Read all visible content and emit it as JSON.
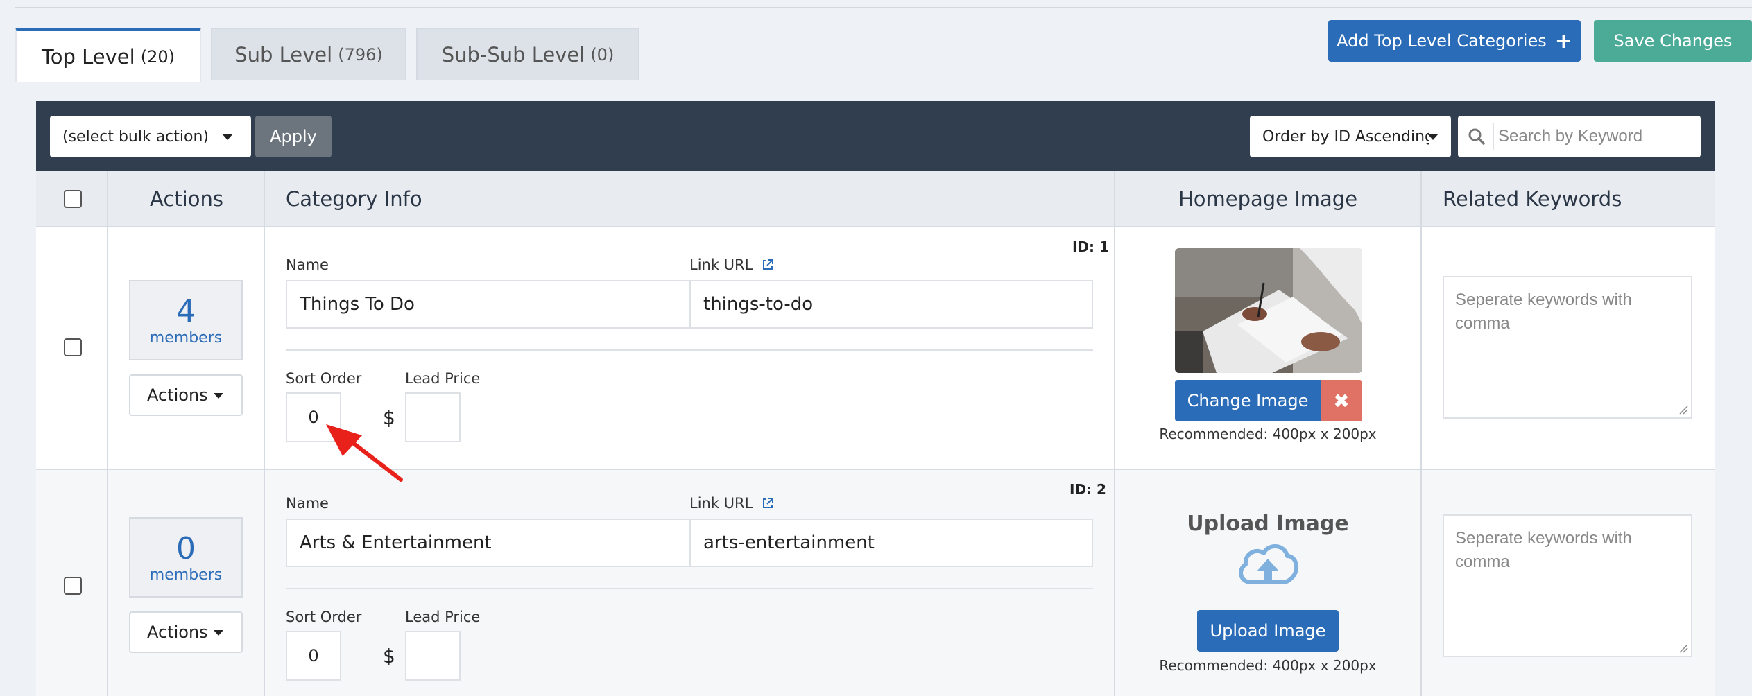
{
  "tabs": [
    {
      "label": "Top Level",
      "count": "(20)"
    },
    {
      "label": "Sub Level",
      "count": "(796)"
    },
    {
      "label": "Sub-Sub Level",
      "count": "(0)"
    }
  ],
  "header_buttons": {
    "add_top": "Add Top Level Categories",
    "add_icon": "+",
    "save": "Save Changes"
  },
  "toolbar": {
    "bulk_action": "(select bulk action)",
    "apply": "Apply",
    "order_by": "Order by ID Ascending",
    "search_placeholder": "Search by Keyword"
  },
  "columns": {
    "actions": "Actions",
    "category_info": "Category Info",
    "homepage_image": "Homepage Image",
    "related_keywords": "Related Keywords"
  },
  "rows": [
    {
      "id_label": "ID: 1",
      "members_count": "4",
      "members_label": "members",
      "actions_label": "Actions",
      "name_label": "Name",
      "name": "Things To Do",
      "link_label": "Link URL",
      "link": "things-to-do",
      "sort_label": "Sort Order",
      "sort_order": "0",
      "lead_label": "Lead Price",
      "currency": "$",
      "lead_price": "",
      "change_image": "Change Image",
      "remove_icon": "✖",
      "recommended": "Recommended: 400px x 200px",
      "keywords_placeholder": "Seperate keywords with comma"
    },
    {
      "id_label": "ID: 2",
      "members_count": "0",
      "members_label": "members",
      "actions_label": "Actions",
      "name_label": "Name",
      "name": "Arts & Entertainment",
      "link_label": "Link URL",
      "link": "arts-entertainment",
      "sort_label": "Sort Order",
      "sort_order": "0",
      "lead_label": "Lead Price",
      "currency": "$",
      "lead_price": "",
      "upload_title": "Upload Image",
      "upload_button": "Upload Image",
      "recommended": "Recommended: 400px x 200px",
      "keywords_placeholder": "Seperate keywords with comma"
    }
  ],
  "colors": {
    "primary": "#2b6cb8",
    "save": "#4cab97",
    "toolbar": "#313e4f",
    "danger": "#e07165",
    "annotation_arrow": "#e8221b"
  }
}
